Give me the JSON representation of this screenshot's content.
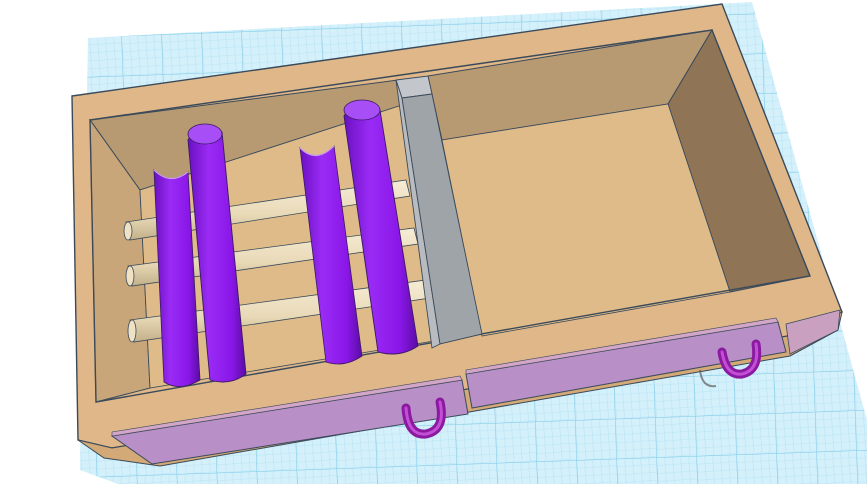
{
  "scene": {
    "colors": {
      "grid_light": "#cfeefa",
      "grid_line": "#8fd3ee",
      "box_rim": "#dfb789",
      "box_outer": "#d2a977",
      "box_floor": "#dfbb8a",
      "box_wall_back": "#b89a72",
      "box_wall_left": "#c9a67a",
      "box_wall_right": "#8f7456",
      "divider_top": "#9fa4a8",
      "divider_face": "#c3c7cb",
      "rod": "#efe2c4",
      "rod_shadow": "#c8b894",
      "purple": "#8a17e8",
      "purple_dark": "#5c0ca6",
      "panel": "#b88fc6",
      "panel_edge": "#d3a5c6",
      "handle": "#8a1aa0",
      "edge": "#3a4a5a"
    },
    "icons": [
      "workplane-grid",
      "storage-box",
      "divider-wall",
      "support-rods",
      "purple-half-pipes",
      "drawer-panels",
      "drawer-handles"
    ]
  }
}
